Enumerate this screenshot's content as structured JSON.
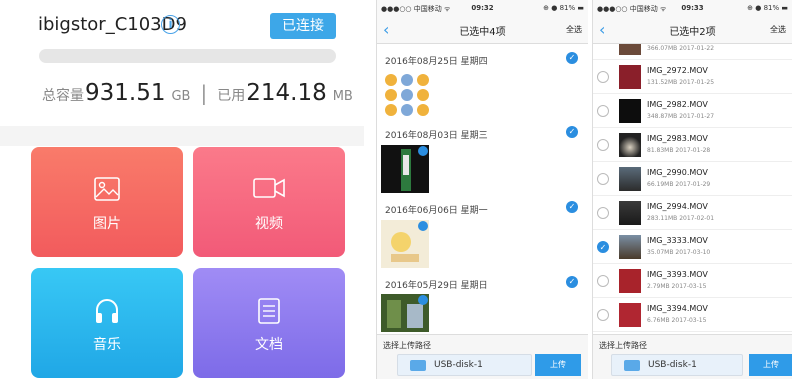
{
  "panel1": {
    "device_name": "ibigstor_C103D9",
    "info_icon": "i",
    "connect_label": "已连接",
    "capacity_total_label": "总容量",
    "capacity_total_value": "931.51",
    "capacity_total_unit": "GB",
    "separator": "|",
    "capacity_used_label": "已用",
    "capacity_used_value": "214.18",
    "capacity_used_unit": "MB",
    "tiles": [
      {
        "label": "图片",
        "icon": "image-icon"
      },
      {
        "label": "视频",
        "icon": "video-camera-icon"
      },
      {
        "label": "音乐",
        "icon": "headphones-icon"
      },
      {
        "label": "文档",
        "icon": "document-icon"
      }
    ]
  },
  "panel2": {
    "status": {
      "carrier": "●●●○○ 中国移动 ᯤ",
      "time": "09:32",
      "battery": "⊕ ● 81% ▬"
    },
    "nav": {
      "back": "‹",
      "title": "已选中4项",
      "select_all": "全选"
    },
    "groups": [
      {
        "date": "2016年08月25日  星期四"
      },
      {
        "date": "2016年08月03日  星期三"
      },
      {
        "date": "2016年06月06日  星期一"
      },
      {
        "date": "2016年05月29日  星期日"
      }
    ],
    "path_label": "选择上传路径",
    "disk_label": "USB-disk-1",
    "upload_label": "上传"
  },
  "panel3": {
    "status": {
      "carrier": "●●●○○ 中国移动 ᯤ",
      "time": "09:33",
      "battery": "⊕ ● 81% ▬"
    },
    "nav": {
      "back": "‹",
      "title": "已选中2项",
      "select_all": "全选"
    },
    "files": [
      {
        "name": "",
        "meta": "366.07MB   2017-01-22",
        "checked": false
      },
      {
        "name": "IMG_2972.MOV",
        "meta": "131.52MB   2017-01-25",
        "checked": false
      },
      {
        "name": "IMG_2982.MOV",
        "meta": "348.87MB   2017-01-27",
        "checked": false
      },
      {
        "name": "IMG_2983.MOV",
        "meta": "81.83MB   2017-01-28",
        "checked": false
      },
      {
        "name": "IMG_2990.MOV",
        "meta": "66.19MB   2017-01-29",
        "checked": false
      },
      {
        "name": "IMG_2994.MOV",
        "meta": "283.11MB   2017-02-01",
        "checked": true
      },
      {
        "name": "IMG_3333.MOV",
        "meta": "35.07MB   2017-03-10",
        "checked": true
      },
      {
        "name": "IMG_3393.MOV",
        "meta": "2.79MB   2017-03-15",
        "checked": false
      },
      {
        "name": "IMG_3394.MOV",
        "meta": "6.76MB   2017-03-15",
        "checked": false
      }
    ],
    "path_label": "选择上传路径",
    "disk_label": "USB-disk-1",
    "upload_label": "上传"
  },
  "colors": {
    "accent": "#3da7e8",
    "tile_image": "#f46a62",
    "tile_video": "#f56a80",
    "tile_music": "#2cb7ee",
    "tile_doc": "#8d7bef"
  }
}
